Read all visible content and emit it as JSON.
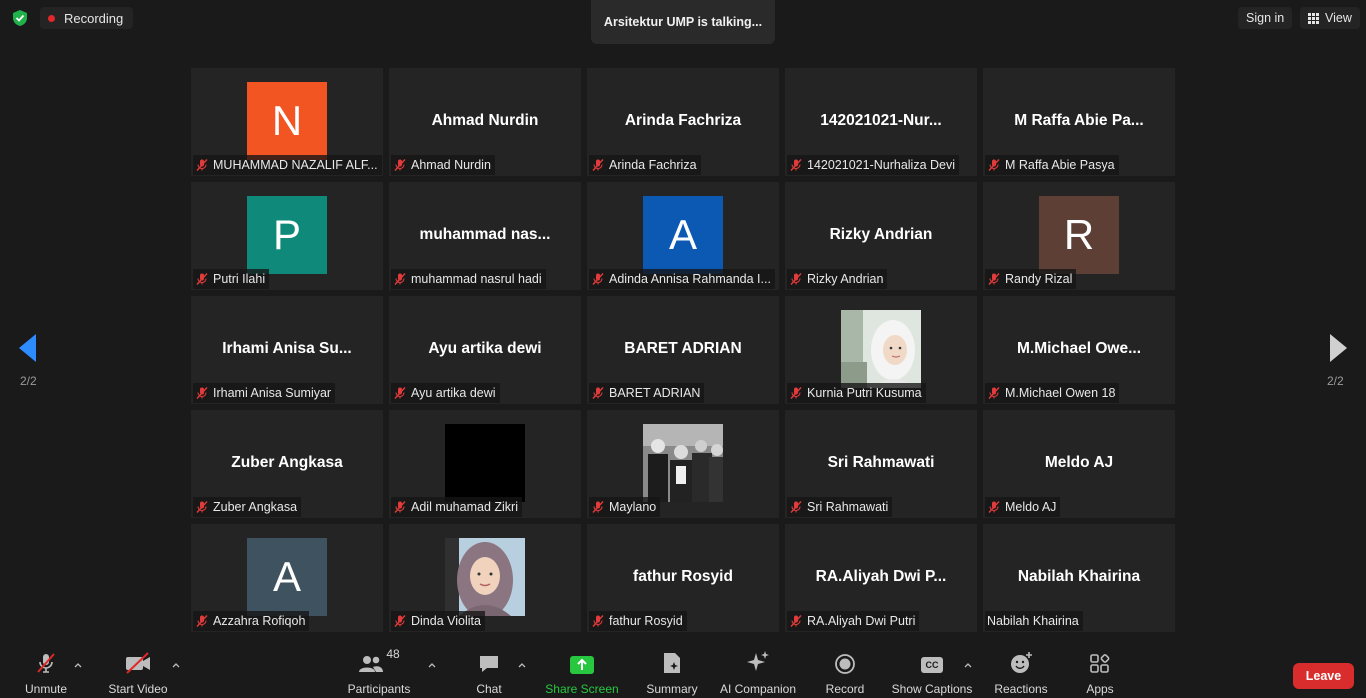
{
  "top": {
    "recording_label": "Recording",
    "talking": "Arsitektur UMP is talking...",
    "signin_label": "Sign in",
    "view_label": "View"
  },
  "pager": {
    "left": "2/2",
    "right": "2/2"
  },
  "tiles": [
    {
      "display": "N",
      "kind": "avatar",
      "color": "#f25522",
      "tag": "MUHAMMAD NAZALIF ALF...",
      "muted": true
    },
    {
      "display": "Ahmad Nurdin",
      "kind": "name",
      "tag": "Ahmad Nurdin",
      "muted": true
    },
    {
      "display": "Arinda Fachriza",
      "kind": "name",
      "tag": "Arinda Fachriza",
      "muted": true
    },
    {
      "display": "142021021-Nur...",
      "kind": "name",
      "tag": "142021021-Nurhaliza Devi",
      "muted": true
    },
    {
      "display": "M Raffa Abie Pa...",
      "kind": "name",
      "tag": "M Raffa Abie Pasya",
      "muted": true
    },
    {
      "display": "P",
      "kind": "avatar",
      "color": "#0f8a7a",
      "tag": "Putri Ilahi",
      "muted": true
    },
    {
      "display": "muhammad  nas...",
      "kind": "name",
      "tag": "muhammad nasrul hadi",
      "muted": true
    },
    {
      "display": "A",
      "kind": "avatar",
      "color": "#0c59b3",
      "tag": "Adinda Annisa Rahmanda I...",
      "muted": true
    },
    {
      "display": "Rizky Andrian",
      "kind": "name",
      "tag": "Rizky Andrian",
      "muted": true
    },
    {
      "display": "R",
      "kind": "avatar",
      "color": "#5e3f36",
      "tag": "Randy Rizal",
      "muted": true
    },
    {
      "display": "Irhami Anisa Su...",
      "kind": "name",
      "tag": "Irhami Anisa Sumiyar",
      "muted": true
    },
    {
      "display": "Ayu artika dewi",
      "kind": "name",
      "tag": "Ayu artika dewi",
      "muted": true
    },
    {
      "display": "BARET ADRIAN",
      "kind": "name",
      "tag": "BARET ADRIAN",
      "muted": true
    },
    {
      "display": "",
      "kind": "photo-hijab-light",
      "tag": "Kurnia Putri Kusuma",
      "muted": true
    },
    {
      "display": "M.Michael  Owe...",
      "kind": "name",
      "tag": "M.Michael Owen 18",
      "muted": true
    },
    {
      "display": "Zuber Angkasa",
      "kind": "name",
      "tag": "Zuber Angkasa",
      "muted": true
    },
    {
      "display": "",
      "kind": "photo-black",
      "tag": "Adil muhamad Zikri",
      "muted": true
    },
    {
      "display": "",
      "kind": "photo-bw",
      "tag": "Maylano",
      "muted": true
    },
    {
      "display": "Sri Rahmawati",
      "kind": "name",
      "tag": "Sri Rahmawati",
      "muted": true
    },
    {
      "display": "Meldo AJ",
      "kind": "name",
      "tag": "Meldo AJ",
      "muted": true
    },
    {
      "display": "A",
      "kind": "avatar",
      "color": "#3f5260",
      "tag": "Azzahra Rofiqoh",
      "muted": true
    },
    {
      "display": "",
      "kind": "photo-hijab",
      "tag": "Dinda Violita",
      "muted": true
    },
    {
      "display": "fathur Rosyid",
      "kind": "name",
      "tag": "fathur Rosyid",
      "muted": true
    },
    {
      "display": "RA.Aliyah  Dwi  P...",
      "kind": "name",
      "tag": "RA.Aliyah Dwi Putri",
      "muted": true
    },
    {
      "display": "Nabilah Khairina",
      "kind": "name",
      "tag": "Nabilah Khairina",
      "muted": false
    }
  ],
  "toolbar": {
    "unmute": "Unmute",
    "start_video": "Start Video",
    "participants": "Participants",
    "participants_count": "48",
    "chat": "Chat",
    "share_screen": "Share Screen",
    "summary": "Summary",
    "ai_companion": "AI Companion",
    "record": "Record",
    "show_captions": "Show Captions",
    "reactions": "Reactions",
    "apps": "Apps",
    "leave": "Leave",
    "captions_icon_text": "CC"
  },
  "colors": {
    "accent": "#2d8cff",
    "leave": "#d92c2c",
    "share": "#27c840",
    "recording_dot": "#e02828"
  }
}
